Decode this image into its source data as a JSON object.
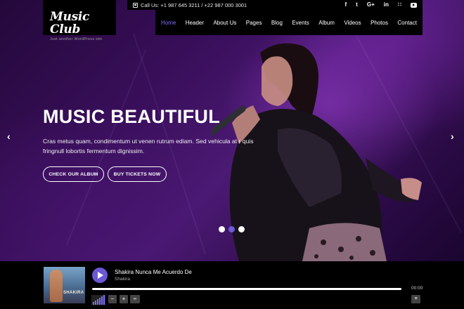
{
  "topbar": {
    "phone_text": "Call Us: +1 987 645 3211 / +22 987 000 3001",
    "socials": [
      {
        "icon": "facebook-icon",
        "glyph": "f"
      },
      {
        "icon": "twitter-icon",
        "glyph": "t"
      },
      {
        "icon": "google-plus-icon",
        "glyph": "G+"
      },
      {
        "icon": "linkedin-icon",
        "glyph": "in"
      },
      {
        "icon": "rss-icon",
        "glyph": "∷"
      },
      {
        "icon": "youtube-icon",
        "glyph": ""
      }
    ]
  },
  "logo": {
    "title": "Music Club",
    "tagline": "Just another WordPress site"
  },
  "nav": {
    "items": [
      "Home",
      "Header",
      "About Us",
      "Pages",
      "Blog",
      "Events",
      "Album",
      "Videos",
      "Photos",
      "Contact"
    ],
    "active_index": 0
  },
  "hero": {
    "title": "MUSIC BEAUTIFUL",
    "text": "Cras metus quam, condimentum ut venen rutrum ediam. Sed vehicula at r quis fringnull lobortis fermentum dignissim.",
    "button_album": "CHECK OUR ALBUM",
    "button_tickets": "BUY TICKETS NOW",
    "prev_glyph": "‹",
    "next_glyph": "›",
    "slide_count": 3,
    "active_slide": 1
  },
  "player": {
    "cover_text": "SHAKIRA",
    "track_title": "Shakira Nunca Me Acuerdo De",
    "artist": "Shakira",
    "time": "00:00",
    "minus": "−",
    "plus": "+",
    "loop": "∞",
    "playlist_glyph": "≡"
  },
  "colors": {
    "accent": "#7e6cff",
    "play_button": "#6c57d6",
    "background": "#000000"
  }
}
